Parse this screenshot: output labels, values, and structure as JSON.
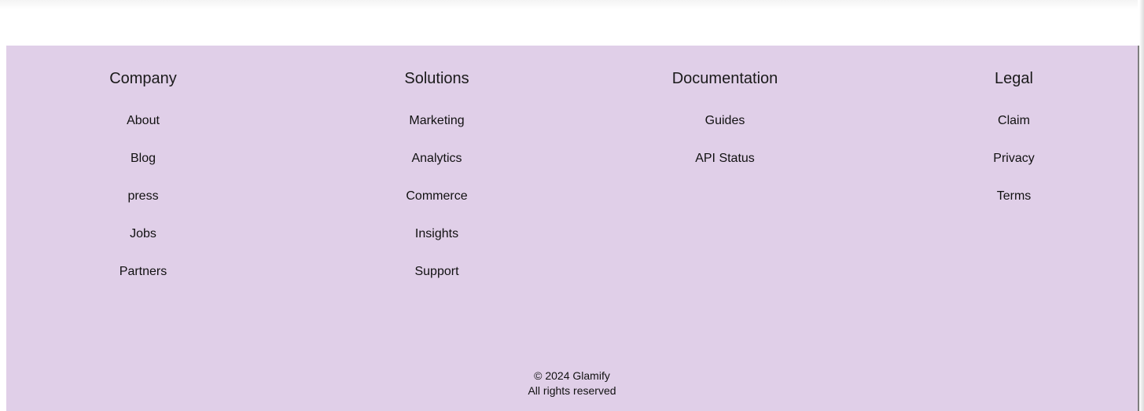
{
  "footer": {
    "columns": [
      {
        "title": "Company",
        "links": [
          "About",
          "Blog",
          "press",
          "Jobs",
          "Partners"
        ]
      },
      {
        "title": "Solutions",
        "links": [
          "Marketing",
          "Analytics",
          "Commerce",
          "Insights",
          "Support"
        ]
      },
      {
        "title": "Documentation",
        "links": [
          "Guides",
          "API Status"
        ]
      },
      {
        "title": "Legal",
        "links": [
          "Claim",
          "Privacy",
          "Terms"
        ]
      }
    ],
    "copyright": {
      "line1": "© 2024 Glamify",
      "line2": "All rights reserved"
    }
  },
  "colors": {
    "footer_background": "#e0cfe8",
    "text": "#111111"
  }
}
